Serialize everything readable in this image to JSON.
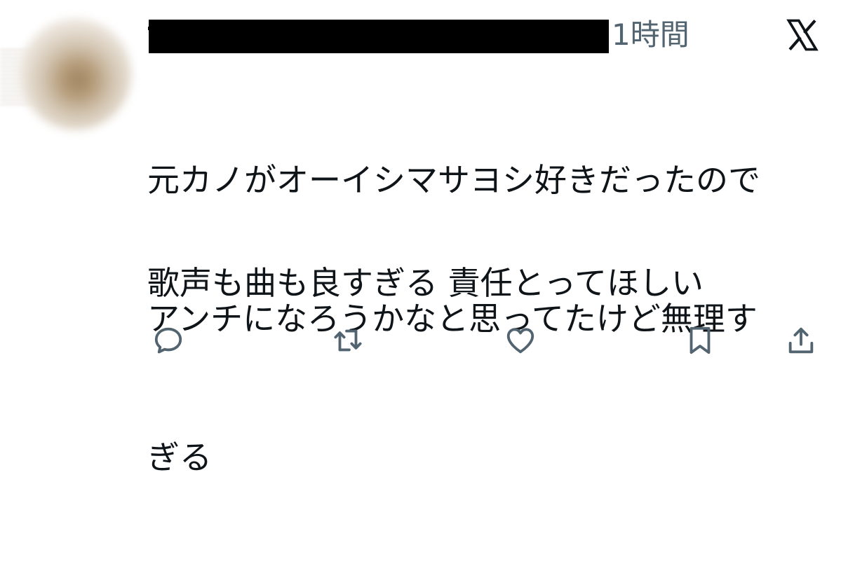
{
  "tweet": {
    "timestamp": "1時間",
    "lines": [
      "元カノがオーイシマサヨシ好きだったので",
      "アンチになろうかなと思ってたけど無理す",
      "ぎる",
      "歌声も曲も良すぎる 責任とってほしい"
    ]
  },
  "icons": {
    "brand": "x-logo-icon",
    "reply": "reply-icon",
    "retweet": "retweet-icon",
    "like": "heart-icon",
    "bookmark": "bookmark-icon",
    "share": "share-icon"
  },
  "colors": {
    "text": "#0f1419",
    "secondary": "#536471",
    "redaction": "#000000"
  }
}
